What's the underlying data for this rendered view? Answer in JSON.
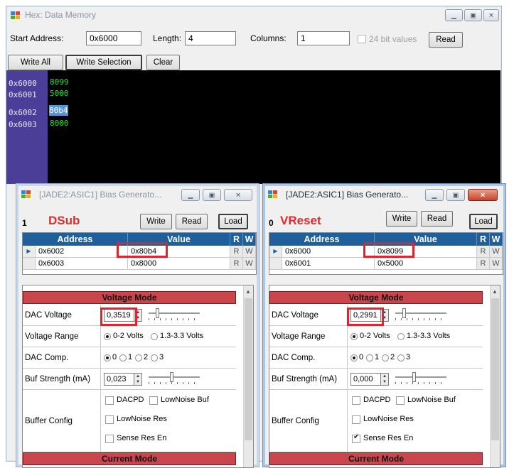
{
  "main": {
    "title": "Hex: Data Memory",
    "start_address_label": "Start Address:",
    "start_address_value": "0x6000",
    "length_label": "Length:",
    "length_value": "4",
    "columns_label": "Columns:",
    "columns_value": "1",
    "bit24_label": "24 bit values",
    "read_label": "Read",
    "write_all_label": "Write All",
    "write_selection_label": "Write Selection",
    "clear_label": "Clear",
    "memory": [
      {
        "addr": "0x6000",
        "value": "8099"
      },
      {
        "addr": "0x6001",
        "value": "5000"
      },
      {
        "addr": "0x6002",
        "value": "80b4"
      },
      {
        "addr": "0x6003",
        "value": "8000"
      }
    ]
  },
  "left": {
    "title": "[JADE2:ASIC1]  Bias Generato...",
    "index": "1",
    "name": "DSub",
    "write_label": "Write",
    "read_label": "Read",
    "load_label": "Load",
    "headers": {
      "address": "Address",
      "value": "Value",
      "r": "R",
      "w": "W"
    },
    "rows": [
      {
        "address": "0x6002",
        "value": "0x80b4",
        "r": "R",
        "w": "W"
      },
      {
        "address": "0x6003",
        "value": "0x8000",
        "r": "R",
        "w": "W"
      }
    ],
    "voltage_mode": "Voltage Mode",
    "dac_voltage_label": "DAC Voltage",
    "dac_voltage_value": "0,3519",
    "voltage_range_label": "Voltage Range",
    "range_opt1": "0-2 Volts",
    "range_opt2": "1.3-3.3 Volts",
    "dac_comp_label": "DAC Comp.",
    "comp_opts": [
      "0",
      "1",
      "2",
      "3"
    ],
    "buf_strength_label": "Buf Strength (mA)",
    "buf_strength_value": "0,023",
    "buffer_config_label": "Buffer Config",
    "dacpd_label": "DACPD",
    "lownoise_buf_label": "LowNoise Buf",
    "lownoise_res_label": "LowNoise Res",
    "sense_res_label": "Sense Res En",
    "current_mode": "Current Mode"
  },
  "right": {
    "title": "[JADE2:ASIC1]  Bias Generato...",
    "index": "0",
    "name": "VReset",
    "write_label": "Write",
    "read_label": "Read",
    "load_label": "Load",
    "headers": {
      "address": "Address",
      "value": "Value",
      "r": "R",
      "w": "W"
    },
    "rows": [
      {
        "address": "0x6000",
        "value": "0x8099",
        "r": "R",
        "w": "W"
      },
      {
        "address": "0x6001",
        "value": "0x5000",
        "r": "R",
        "w": "W"
      }
    ],
    "voltage_mode": "Voltage Mode",
    "dac_voltage_label": "DAC Voltage",
    "dac_voltage_value": "0,2991",
    "voltage_range_label": "Voltage Range",
    "range_opt1": "0-2 Volts",
    "range_opt2": "1.3-3.3 Volts",
    "dac_comp_label": "DAC Comp.",
    "comp_opts": [
      "0",
      "1",
      "2",
      "3"
    ],
    "buf_strength_label": "Buf Strength (mA)",
    "buf_strength_value": "0,000",
    "buffer_config_label": "Buffer Config",
    "dacpd_label": "DACPD",
    "lownoise_buf_label": "LowNoise Buf",
    "lownoise_res_label": "LowNoise Res",
    "sense_res_label": "Sense Res En",
    "current_mode": "Current Mode"
  }
}
